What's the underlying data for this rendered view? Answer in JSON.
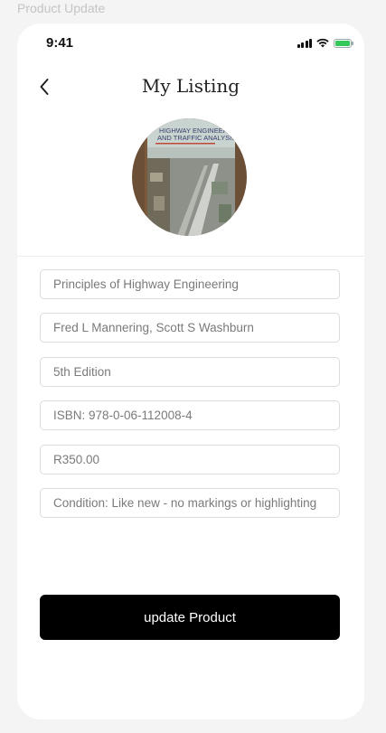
{
  "frame": {
    "label": "Product Update"
  },
  "status_bar": {
    "time": "9:41"
  },
  "header": {
    "title": "My Listing",
    "back_icon": "chevron-left-icon"
  },
  "book_cover": {
    "title_line_1": "HIGHWAY ENGINEERING",
    "title_line_2": "AND TRAFFIC ANALYSIS",
    "colors": {
      "sky": "#c9d3cf",
      "road": "#8d9189",
      "spine": "#7b5a3c",
      "title_text": "#3a3f70"
    }
  },
  "form": {
    "title": "Principles of Highway Engineering",
    "authors": "Fred L Mannering, Scott S Washburn",
    "edition": "5th Edition",
    "isbn": "ISBN: 978-0-06-112008-4",
    "price": "R350.00",
    "condition": "Condition: Like new - no markings or highlighting"
  },
  "actions": {
    "update_label": "update Product"
  },
  "colors": {
    "background": "#f4f4f4",
    "button": "#000000",
    "battery": "#34c759"
  }
}
